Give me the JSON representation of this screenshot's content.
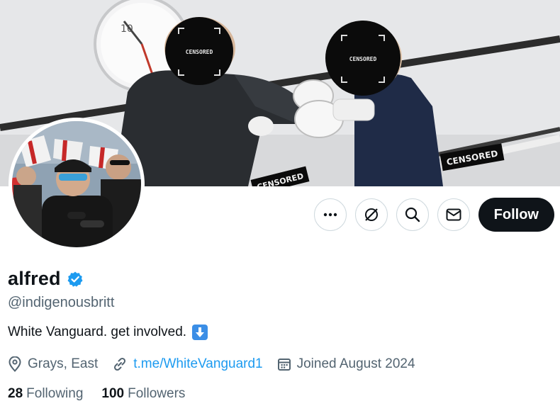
{
  "banner": {
    "censor_labels": [
      "CENSORED",
      "CENSORED",
      "CENSORED",
      "CENSORED"
    ],
    "clock_numeral": "10"
  },
  "profile": {
    "display_name": "alfred",
    "verified": true,
    "handle": "@indigenousbritt",
    "bio": "White Vanguard. get involved.",
    "bio_emoji": "down-arrow-emoji",
    "location": "Grays, East",
    "link": "t.me/WhiteVanguard1",
    "joined": "Joined August 2024",
    "following_count": "28",
    "following_label": "Following",
    "followers_count": "100",
    "followers_label": "Followers"
  },
  "actions": {
    "more_icon": "more-icon",
    "grok_icon": "grok-icon",
    "search_icon": "search-icon",
    "message_icon": "message-icon",
    "follow_label": "Follow"
  },
  "colors": {
    "text_primary": "#0f1419",
    "text_secondary": "#536471",
    "link": "#1d9bf0",
    "verified": "#1d9bf0",
    "follow_bg": "#0f1419",
    "border": "#cfd9de"
  }
}
